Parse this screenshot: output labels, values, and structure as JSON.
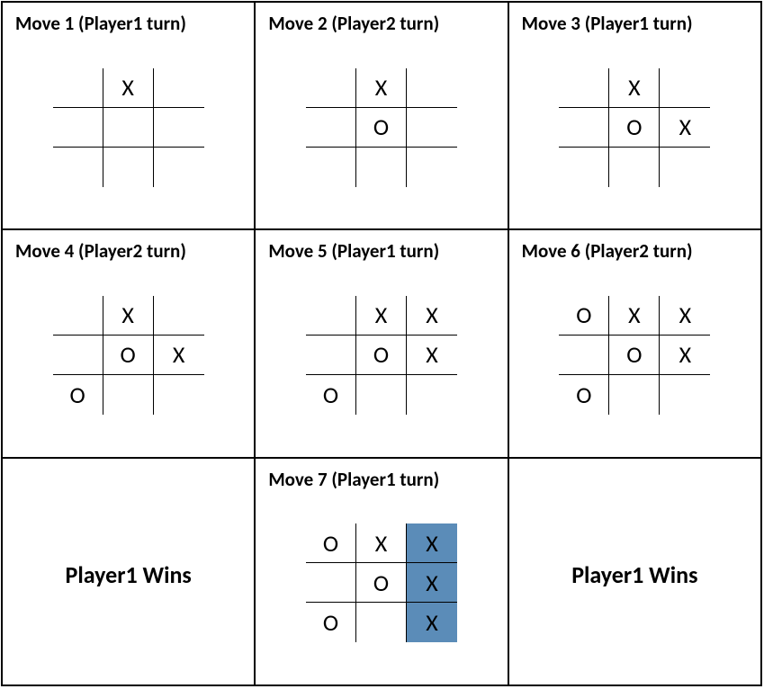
{
  "chart_data": {
    "type": "table",
    "description": "Tic-tac-toe game progression, 7 moves, Player1 (X) wins with right column",
    "players": {
      "player1": "X",
      "player2": "O"
    },
    "winner": "Player1",
    "winning_cells": [
      [
        0,
        2
      ],
      [
        1,
        2
      ],
      [
        2,
        2
      ]
    ],
    "moves": [
      {
        "move": 1,
        "turn": "Player1",
        "board": [
          [
            "",
            "X",
            ""
          ],
          [
            "",
            "",
            ""
          ],
          [
            "",
            "",
            ""
          ]
        ]
      },
      {
        "move": 2,
        "turn": "Player2",
        "board": [
          [
            "",
            "X",
            ""
          ],
          [
            "",
            "O",
            ""
          ],
          [
            "",
            "",
            ""
          ]
        ]
      },
      {
        "move": 3,
        "turn": "Player1",
        "board": [
          [
            "",
            "X",
            ""
          ],
          [
            "",
            "O",
            "X"
          ],
          [
            "",
            "",
            ""
          ]
        ]
      },
      {
        "move": 4,
        "turn": "Player2",
        "board": [
          [
            "",
            "X",
            ""
          ],
          [
            "",
            "O",
            "X"
          ],
          [
            "O",
            "",
            ""
          ]
        ]
      },
      {
        "move": 5,
        "turn": "Player1",
        "board": [
          [
            "",
            "X",
            "X"
          ],
          [
            "",
            "O",
            "X"
          ],
          [
            "O",
            "",
            ""
          ]
        ]
      },
      {
        "move": 6,
        "turn": "Player2",
        "board": [
          [
            "O",
            "X",
            "X"
          ],
          [
            "",
            "O",
            "X"
          ],
          [
            "O",
            "",
            ""
          ]
        ]
      },
      {
        "move": 7,
        "turn": "Player1",
        "board": [
          [
            "O",
            "X",
            "X"
          ],
          [
            "",
            "O",
            "X"
          ],
          [
            "O",
            "",
            "X"
          ]
        ]
      }
    ]
  },
  "panels": [
    {
      "kind": "move",
      "title": "Move 1 (Player1 turn)",
      "moveIndex": 0,
      "highlight": []
    },
    {
      "kind": "move",
      "title": "Move 2 (Player2 turn)",
      "moveIndex": 1,
      "highlight": []
    },
    {
      "kind": "move",
      "title": "Move 3 (Player1 turn)",
      "moveIndex": 2,
      "highlight": []
    },
    {
      "kind": "move",
      "title": "Move 4 (Player2 turn)",
      "moveIndex": 3,
      "highlight": []
    },
    {
      "kind": "move",
      "title": "Move 5 (Player1 turn)",
      "moveIndex": 4,
      "highlight": []
    },
    {
      "kind": "move",
      "title": "Move 6 (Player2 turn)",
      "moveIndex": 5,
      "highlight": []
    },
    {
      "kind": "win",
      "text": "Player1 Wins"
    },
    {
      "kind": "move",
      "title": "Move 7 (Player1 turn)",
      "moveIndex": 6,
      "highlight": [
        [
          0,
          2
        ],
        [
          1,
          2
        ],
        [
          2,
          2
        ]
      ]
    },
    {
      "kind": "win",
      "text": "Player1 Wins"
    }
  ]
}
